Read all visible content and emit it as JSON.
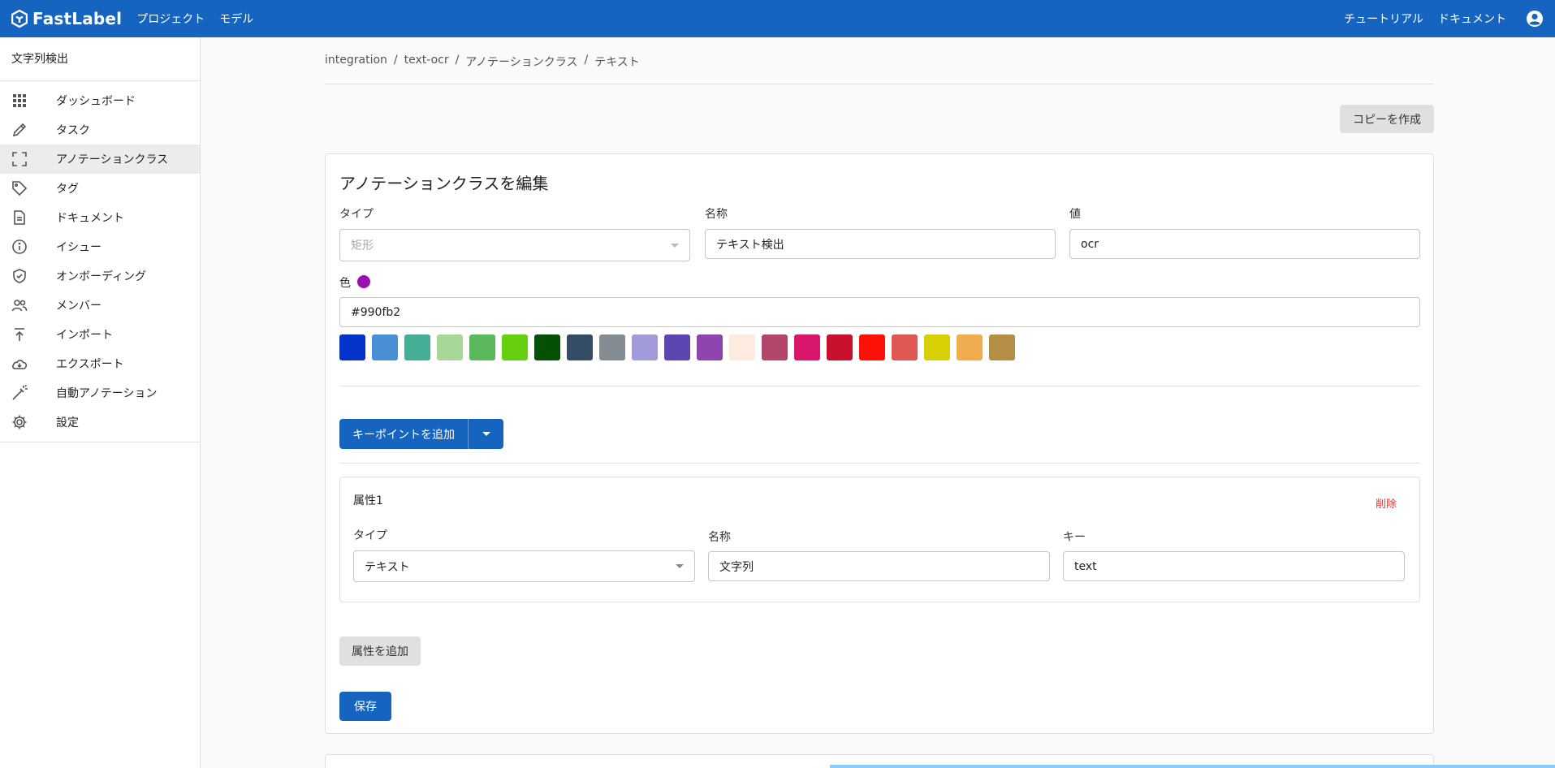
{
  "header": {
    "brand": "FastLabel",
    "nav": [
      "プロジェクト",
      "モデル"
    ],
    "right_nav": [
      "チュートリアル",
      "ドキュメント"
    ],
    "icons": {
      "logo": "fastlabel-logo-icon",
      "account": "account-circle-icon"
    }
  },
  "sidebar": {
    "project_name": "文字列検出",
    "active_item": "アノテーションクラス",
    "items": [
      {
        "label": "ダッシュボード",
        "icon": "grid-icon"
      },
      {
        "label": "タスク",
        "icon": "pencil-icon"
      },
      {
        "label": "アノテーションクラス",
        "icon": "crop-frame-icon"
      },
      {
        "label": "タグ",
        "icon": "tag-icon"
      },
      {
        "label": "ドキュメント",
        "icon": "document-icon"
      },
      {
        "label": "イシュー",
        "icon": "info-icon"
      },
      {
        "label": "オンボーディング",
        "icon": "shield-check-icon"
      },
      {
        "label": "メンバー",
        "icon": "people-icon"
      },
      {
        "label": "インポート",
        "icon": "upload-icon"
      },
      {
        "label": "エクスポート",
        "icon": "cloud-download-icon"
      },
      {
        "label": "自動アノテーション",
        "icon": "magic-wand-icon"
      },
      {
        "label": "設定",
        "icon": "gear-icon"
      }
    ]
  },
  "breadcrumb": [
    "integration",
    "text-ocr",
    "アノテーションクラス",
    "テキスト"
  ],
  "copy_button": "コピーを作成",
  "form": {
    "title": "アノテーションクラスを編集",
    "type": {
      "label": "タイプ",
      "value": "矩形"
    },
    "name": {
      "label": "名称",
      "value": "テキスト検出"
    },
    "value": {
      "label": "値",
      "value": "ocr"
    },
    "color": {
      "label": "色",
      "value": "#990fb2"
    },
    "swatches": [
      "#0433c9",
      "#4a8fd6",
      "#45ad95",
      "#a8d696",
      "#5cb85c",
      "#66cf10",
      "#045004",
      "#354c66",
      "#838d91",
      "#a29bd9",
      "#5d45b2",
      "#8e44ad",
      "#fdebdf",
      "#b2476b",
      "#d8166c",
      "#c9102e",
      "#fe1108",
      "#df5851",
      "#d6d004",
      "#efad4f",
      "#b38e44"
    ],
    "add_keypoint": "キーポイントを追加",
    "attribute": {
      "title": "属性1",
      "delete": "削除",
      "type": {
        "label": "タイプ",
        "value": "テキスト"
      },
      "name": {
        "label": "名称",
        "value": "文字列"
      },
      "key": {
        "label": "キー",
        "value": "text"
      }
    },
    "add_attribute": "属性を追加",
    "save": "保存"
  },
  "colors": {
    "primary": "#1565c0",
    "danger": "#e53935",
    "active_bg": "#ececec"
  }
}
